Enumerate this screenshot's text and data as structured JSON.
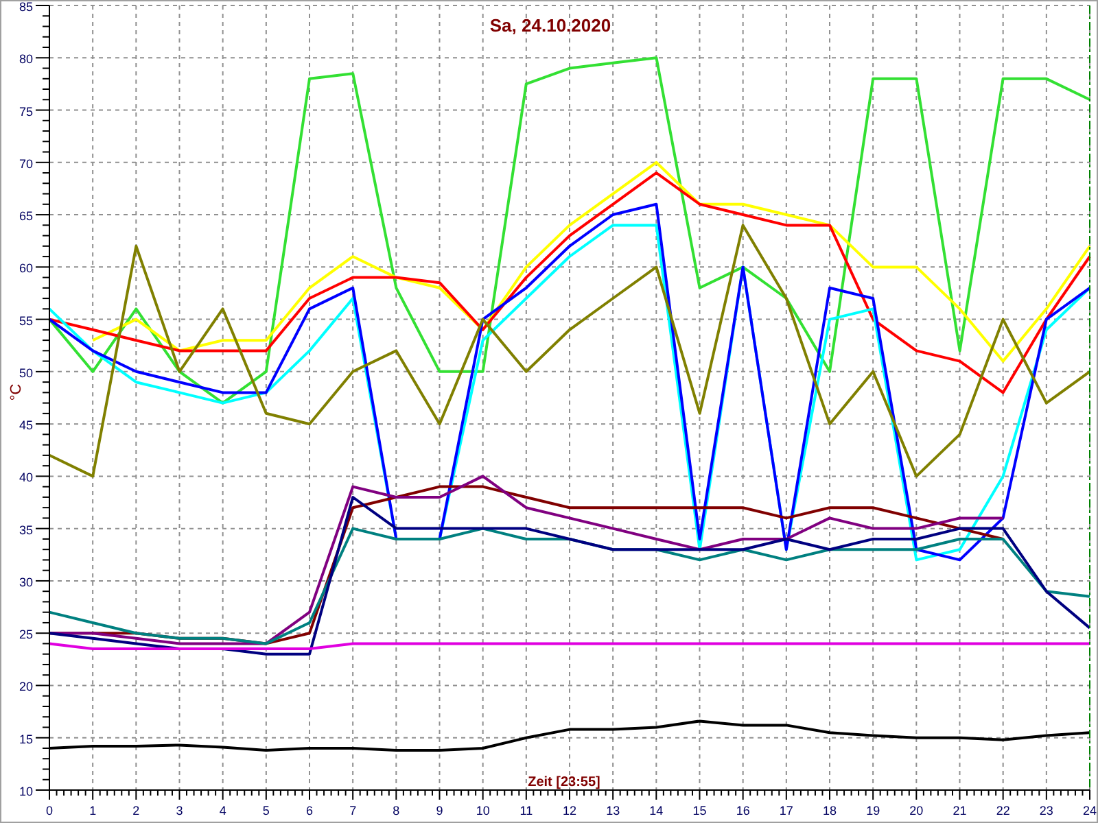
{
  "chart": {
    "chart_data": {
      "type": "line",
      "title": "Sa, 24.10.2020",
      "xlabel": "Zeit [23:55]",
      "ylabel": "°C",
      "x": [
        0,
        1,
        2,
        3,
        4,
        5,
        6,
        7,
        8,
        9,
        10,
        11,
        12,
        13,
        14,
        15,
        16,
        17,
        18,
        19,
        20,
        21,
        22,
        23,
        24
      ],
      "grid": true,
      "xlim": [
        0,
        24
      ],
      "ylim": [
        10,
        85
      ],
      "xticks": [
        0,
        1,
        2,
        3,
        4,
        5,
        6,
        7,
        8,
        9,
        10,
        11,
        12,
        13,
        14,
        15,
        16,
        17,
        18,
        19,
        20,
        21,
        22,
        23,
        24
      ],
      "yticks": [
        10,
        15,
        20,
        25,
        30,
        35,
        40,
        45,
        50,
        55,
        60,
        65,
        70,
        75,
        80,
        85
      ],
      "series": [
        {
          "color": "#33e033",
          "values": [
            55,
            50,
            56,
            50,
            47,
            50,
            78,
            78.5,
            58,
            50,
            50,
            77.5,
            79,
            79.5,
            80,
            58,
            60,
            57,
            50,
            78,
            78,
            52,
            78,
            78,
            76
          ]
        },
        {
          "color": "#ffff00",
          "values": [
            null,
            53,
            55,
            52,
            53,
            53,
            58,
            61,
            59,
            58,
            54,
            60,
            64,
            67,
            70,
            66,
            66,
            65,
            64,
            60,
            60,
            56,
            51,
            56,
            62
          ]
        },
        {
          "color": "#ff0000",
          "values": [
            55,
            54,
            53,
            52,
            52,
            52,
            57,
            59,
            59,
            58.5,
            54,
            59,
            63,
            66,
            69,
            66,
            65,
            64,
            64,
            55,
            52,
            51,
            48,
            55,
            61
          ]
        },
        {
          "color": "#00ffff",
          "values": [
            56,
            52,
            49,
            48,
            47,
            48,
            52,
            57,
            34,
            34,
            53,
            57,
            61,
            64,
            64,
            33,
            60,
            33,
            55,
            56,
            32,
            33,
            40,
            54,
            58
          ]
        },
        {
          "color": "#0000ff",
          "values": [
            55,
            52,
            50,
            49,
            48,
            48,
            56,
            58,
            34,
            34,
            55,
            58,
            62,
            65,
            66,
            34,
            60,
            33,
            58,
            57,
            33,
            32,
            36,
            55,
            58
          ]
        },
        {
          "color": "#808000",
          "values": [
            42,
            40,
            62,
            50,
            56,
            46,
            45,
            50,
            52,
            45,
            55,
            50,
            54,
            57,
            60,
            46,
            64,
            57,
            45,
            50,
            40,
            44,
            55,
            47,
            50
          ]
        },
        {
          "color": "#800000",
          "values": [
            25,
            25,
            25,
            24.5,
            24.5,
            24,
            25,
            37,
            38,
            39,
            39,
            38,
            37,
            37,
            37,
            37,
            37,
            36,
            37,
            37,
            36,
            35,
            34,
            null,
            null
          ]
        },
        {
          "color": "#800080",
          "values": [
            25,
            25,
            24.5,
            24,
            24,
            24,
            27,
            39,
            38,
            38,
            40,
            37,
            36,
            35,
            34,
            33,
            34,
            34,
            36,
            35,
            35,
            36,
            36,
            null,
            null
          ]
        },
        {
          "color": "#008080",
          "values": [
            27,
            26,
            25,
            24.5,
            24.5,
            24,
            26,
            35,
            34,
            34,
            35,
            34,
            34,
            33,
            33,
            32,
            33,
            32,
            33,
            33,
            33,
            34,
            34,
            29,
            28.5
          ]
        },
        {
          "color": "#000080",
          "values": [
            25,
            24.5,
            24,
            23.5,
            23.5,
            23,
            23,
            38,
            35,
            35,
            35,
            35,
            34,
            33,
            33,
            33,
            33,
            34,
            33,
            34,
            34,
            35,
            35,
            29,
            25.5
          ]
        },
        {
          "color": "#e000e0",
          "values": [
            24,
            23.5,
            23.5,
            23.5,
            23.5,
            23.5,
            23.5,
            24,
            24,
            24,
            24,
            24,
            24,
            24,
            24,
            24,
            24,
            24,
            24,
            24,
            24,
            24,
            24,
            24,
            24
          ]
        },
        {
          "color": "#000000",
          "values": [
            14,
            14.2,
            14.2,
            14.3,
            14.1,
            13.8,
            14,
            14,
            13.8,
            13.8,
            14,
            15,
            15.8,
            15.8,
            16,
            16.6,
            16.2,
            16.2,
            15.5,
            15.2,
            15,
            15,
            14.8,
            15.2,
            15.5
          ]
        }
      ]
    }
  }
}
